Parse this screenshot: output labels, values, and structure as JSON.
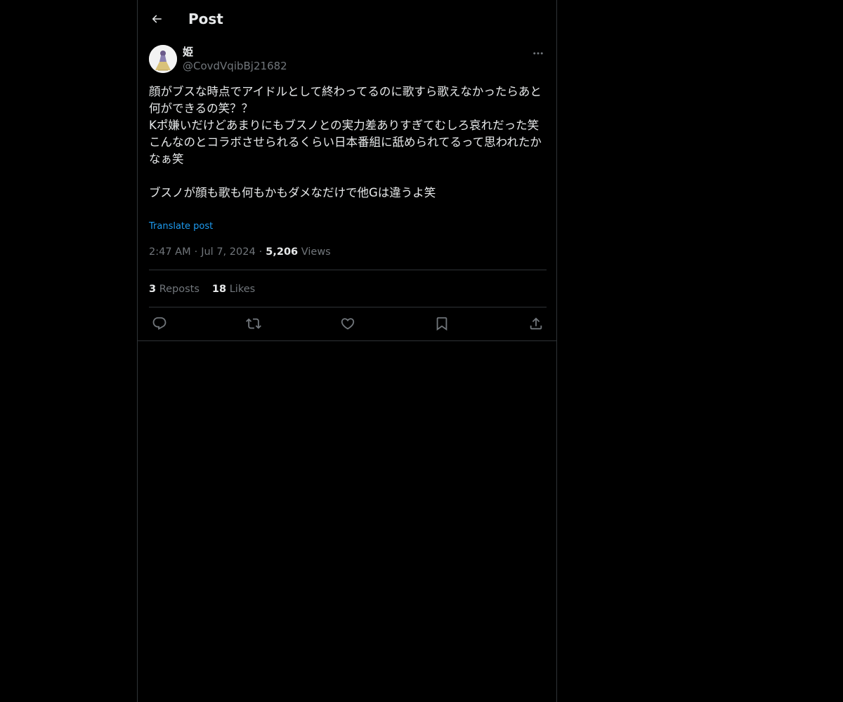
{
  "header": {
    "title": "Post",
    "back_icon": "arrow-left-icon"
  },
  "post": {
    "author": {
      "display_name": "姫",
      "handle": "@CovdVqibBj21682",
      "avatar_icon": "avatar-figure"
    },
    "text_lines": [
      "顔がブスな時点でアイドルとして終わってるのに歌すら歌えなかったらあと何ができるの笑？？",
      "Kポ嫌いだけどあまりにもブスノとの実力差ありすぎてむしろ哀れだった笑",
      "こんなのとコラボさせられるくらい日本番組に舐められてるって思われたかなぁ笑",
      "",
      "ブスノが顔も歌も何もかもダメなだけで他Gは違うよ笑"
    ],
    "translate_label": "Translate post",
    "time": "2:47 AM",
    "date": "Jul 7, 2024",
    "views_count": "5,206",
    "views_label": "Views",
    "separator": "·",
    "reposts_count": "3",
    "reposts_label": "Reposts",
    "likes_count": "18",
    "likes_label": "Likes"
  },
  "actions": [
    {
      "name": "reply",
      "icon": "reply-icon"
    },
    {
      "name": "repost",
      "icon": "repost-icon"
    },
    {
      "name": "like",
      "icon": "heart-icon"
    },
    {
      "name": "bookmark",
      "icon": "bookmark-icon"
    },
    {
      "name": "share",
      "icon": "share-icon"
    }
  ],
  "colors": {
    "background": "#000000",
    "text": "#e7e9ea",
    "secondary": "#71767b",
    "link": "#1d9bf0",
    "border": "#2f3336"
  }
}
